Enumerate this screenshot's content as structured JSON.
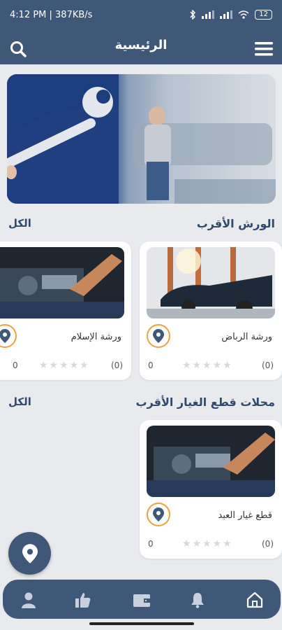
{
  "status": {
    "left": "4:12 PM | 387KB/s",
    "battery": "12"
  },
  "header": {
    "title": "الرئيسية"
  },
  "sections": {
    "workshops": {
      "title": "الورش الأقرب",
      "all": "الكل"
    },
    "parts": {
      "title": "محلات قطع الغيار الأقرب",
      "all": "الكل"
    }
  },
  "workshops": [
    {
      "name": "ورشة الرباض",
      "count": "(0)",
      "score": "0",
      "stars": "★★★★★"
    },
    {
      "name": "ورشة الإسلام",
      "count": "(0)",
      "score": "0",
      "stars": "★★★★★"
    }
  ],
  "parts": [
    {
      "name": "قطع غيار العبد",
      "count": "(0)",
      "score": "0",
      "stars": "★★★★★"
    }
  ],
  "colors": {
    "primary": "#3f5877",
    "accent": "#f0a040",
    "background": "#e9eaed"
  }
}
